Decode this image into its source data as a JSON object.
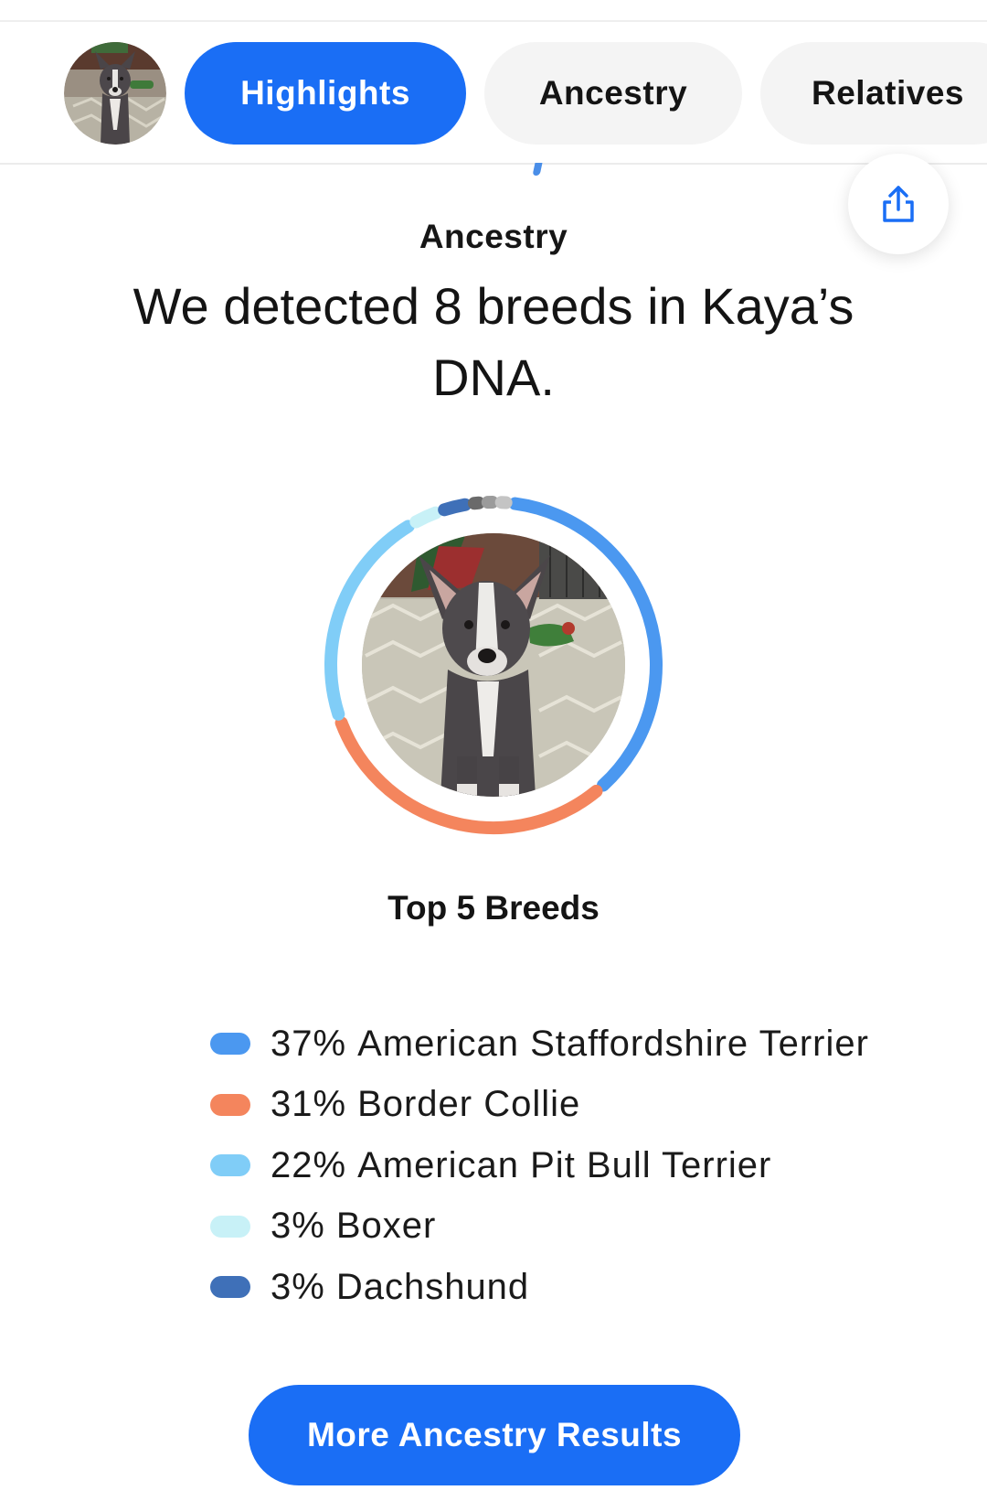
{
  "tabs": [
    {
      "label": "Highlights",
      "active": true
    },
    {
      "label": "Ancestry",
      "active": false
    },
    {
      "label": "Relatives",
      "active": false
    }
  ],
  "section_label": "Ancestry",
  "headline": "We detected 8 breeds in Kaya’s DNA.",
  "top_breeds_label": "Top 5 Breeds",
  "breeds": [
    {
      "percent": "37%",
      "name": "American Staffordshire Terrier",
      "value": 37,
      "color": "#4b98f0"
    },
    {
      "percent": "31%",
      "name": "Border Collie",
      "value": 31,
      "color": "#f4855d"
    },
    {
      "percent": "22%",
      "name": "American Pit Bull Terrier",
      "value": 22,
      "color": "#80cdf7"
    },
    {
      "percent": "3%",
      "name": "Boxer",
      "value": 3,
      "color": "#c8f1f7"
    },
    {
      "percent": "3%",
      "name": "Dachshund",
      "value": 3,
      "color": "#3f70b8"
    }
  ],
  "other_breed_colors": [
    "#6a6a6a",
    "#9b9b9b",
    "#c4c4c4"
  ],
  "cta_label": "More Ancestry Results",
  "icons": {
    "share": "share-icon",
    "avatar": "dog-avatar",
    "photo": "dog-photo"
  }
}
